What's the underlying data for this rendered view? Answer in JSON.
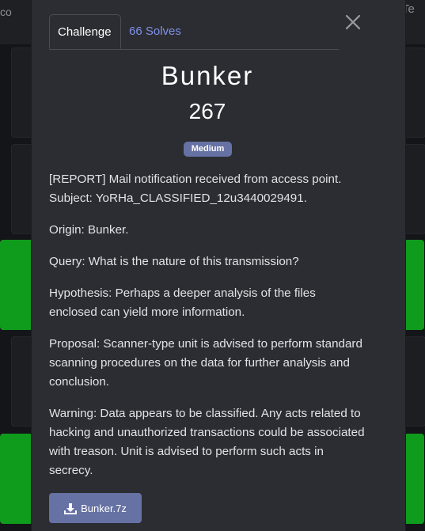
{
  "background": {
    "nav_left_text": "co",
    "nav_right_text": "Te"
  },
  "modal": {
    "tabs": [
      {
        "label": "Challenge",
        "active": true
      },
      {
        "label": "66 Solves",
        "active": false
      }
    ],
    "close_icon": "close-icon",
    "challenge": {
      "name": "Bunker",
      "points": "267",
      "difficulty": "Medium",
      "description": [
        "[REPORT] Mail notification received from access point. Subject: YoRHa_CLASSIFIED_12u3440029491.",
        "Origin: Bunker.",
        "Query: What is the nature of this transmission?",
        "Hypothesis: Perhaps a deeper analysis of the files enclosed can yield more information.",
        "Proposal: Scanner-type unit is advised to perform standard scanning procedures on the data for further analysis and conclusion.",
        "Warning: Data appears to be classified. Any acts related to hacking and unauthorized transactions could be associated with treason. Unit is advised to perform such acts in secrecy."
      ],
      "file": {
        "label": "Bunker.7z",
        "icon": "download-icon"
      }
    }
  },
  "colors": {
    "accent": "#6672a3",
    "link": "#7f90e8",
    "solved_green": "#0f9b1c"
  }
}
